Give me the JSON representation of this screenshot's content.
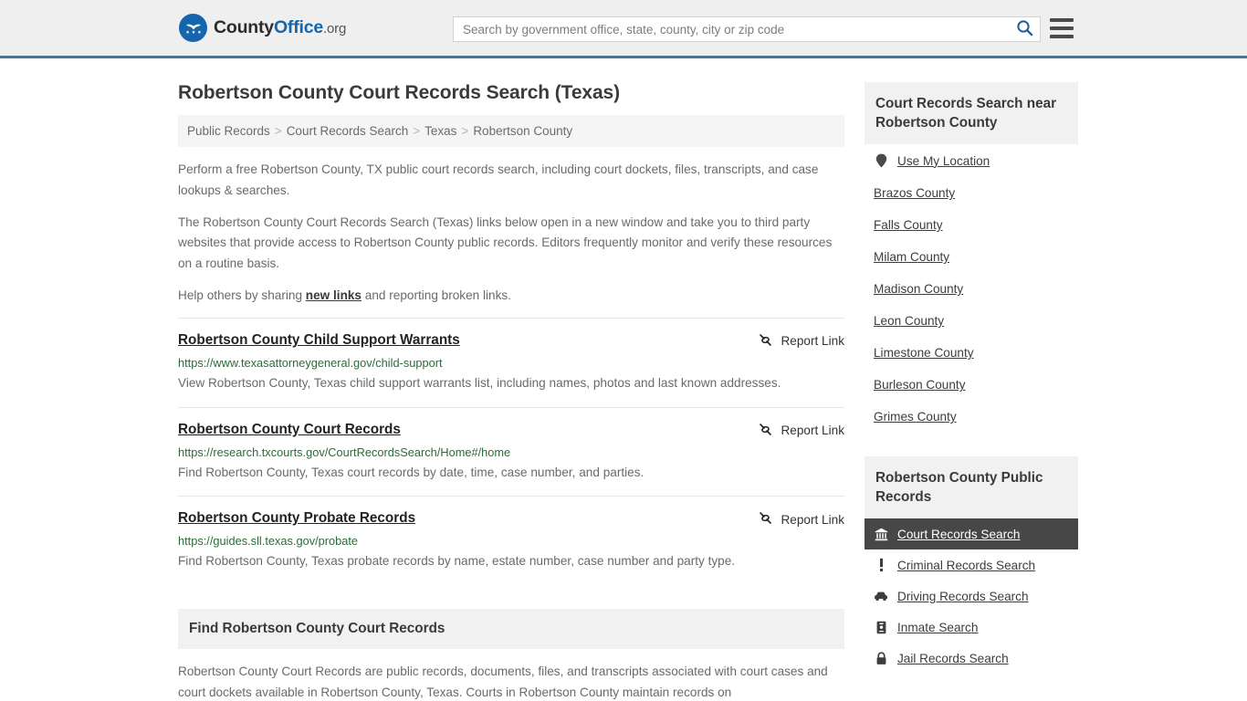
{
  "header": {
    "logo": {
      "part1": "County",
      "part2": "Office",
      "tld": ".org",
      "icon": "eagle-seal-icon"
    },
    "search": {
      "placeholder": "Search by government office, state, county, city or zip code",
      "value": "",
      "icon": "search-icon"
    },
    "menu_icon": "hamburger-menu-icon",
    "accent_color": "#3c7ba6"
  },
  "page": {
    "title": "Robertson County Court Records Search (Texas)"
  },
  "breadcrumb": {
    "items": [
      {
        "label": "Public Records"
      },
      {
        "label": "Court Records Search"
      },
      {
        "label": "Texas"
      },
      {
        "label": "Robertson County"
      }
    ],
    "separator": ">"
  },
  "intro": {
    "p1": "Perform a free Robertson County, TX public court records search, including court dockets, files, transcripts, and case lookups & searches.",
    "p2": "The Robertson County Court Records Search (Texas) links below open in a new window and take you to third party websites that provide access to Robertson County public records. Editors frequently monitor and verify these resources on a routine basis.",
    "p3_before": "Help others by sharing ",
    "p3_link": "new links",
    "p3_after": " and reporting broken links."
  },
  "report_link_label": "Report Link",
  "report_link_icon": "broken-link-icon",
  "results": [
    {
      "title": "Robertson County Child Support Warrants",
      "url": "https://www.texasattorneygeneral.gov/child-support",
      "description": "View Robertson County, Texas child support warrants list, including names, photos and last known addresses."
    },
    {
      "title": "Robertson County Court Records",
      "url": "https://research.txcourts.gov/CourtRecordsSearch/Home#/home",
      "description": "Find Robertson County, Texas court records by date, time, case number, and parties."
    },
    {
      "title": "Robertson County Probate Records",
      "url": "https://guides.sll.texas.gov/probate",
      "description": "Find Robertson County, Texas probate records by name, estate number, case number and party type."
    }
  ],
  "find_section": {
    "heading": "Find Robertson County Court Records",
    "paragraph": "Robertson County Court Records are public records, documents, files, and transcripts associated with court cases and court dockets available in Robertson County, Texas. Courts in Robertson County maintain records on"
  },
  "sidebar": {
    "nearby": {
      "heading": "Court Records Search near Robertson County",
      "items": [
        {
          "label": "Use My Location",
          "icon": "map-pin-icon"
        },
        {
          "label": "Brazos County",
          "icon": ""
        },
        {
          "label": "Falls County",
          "icon": ""
        },
        {
          "label": "Milam County",
          "icon": ""
        },
        {
          "label": "Madison County",
          "icon": ""
        },
        {
          "label": "Leon County",
          "icon": ""
        },
        {
          "label": "Limestone County",
          "icon": ""
        },
        {
          "label": "Burleson County",
          "icon": ""
        },
        {
          "label": "Grimes County",
          "icon": ""
        }
      ]
    },
    "public_records": {
      "heading": "Robertson County Public Records",
      "items": [
        {
          "label": "Court Records Search",
          "icon": "courthouse-icon",
          "active": true
        },
        {
          "label": "Criminal Records Search",
          "icon": "exclamation-icon",
          "active": false
        },
        {
          "label": "Driving Records Search",
          "icon": "car-icon",
          "active": false
        },
        {
          "label": "Inmate Search",
          "icon": "id-badge-icon",
          "active": false
        },
        {
          "label": "Jail Records Search",
          "icon": "lock-icon",
          "active": false
        }
      ]
    }
  }
}
